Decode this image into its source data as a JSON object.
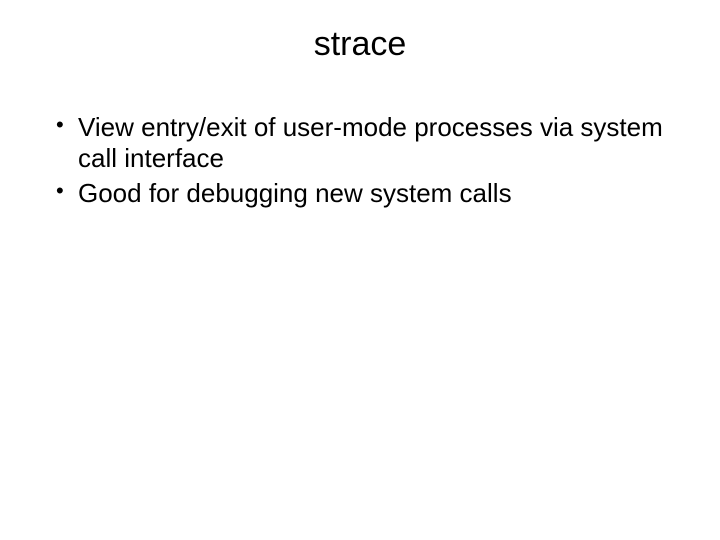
{
  "slide": {
    "title": "strace",
    "bullets": [
      "View entry/exit of user-mode processes via system call interface",
      "Good for debugging new system calls"
    ]
  }
}
